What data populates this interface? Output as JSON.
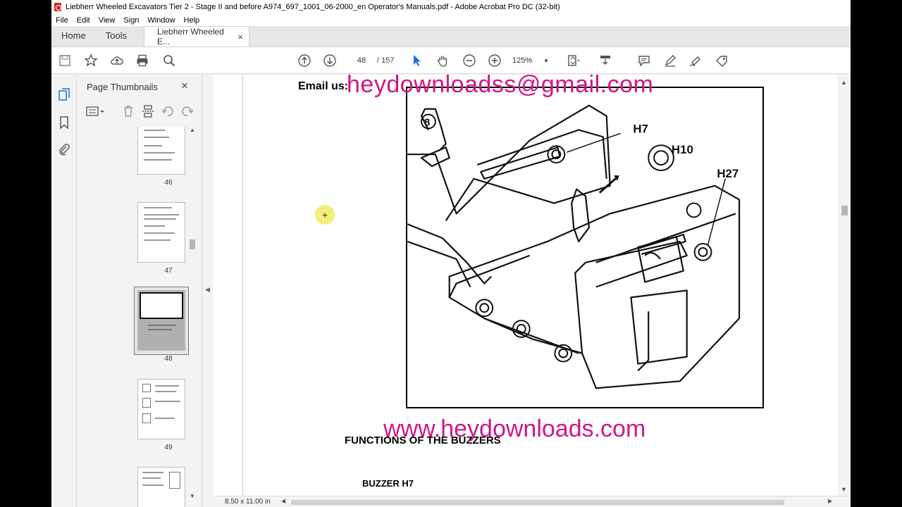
{
  "window": {
    "title": "Liebherr Wheeled Excavators Tier 2 - Stage II and before A974_697_1001_06-2000_en Operator's Manuals.pdf - Adobe Acrobat Pro DC (32-bit)"
  },
  "menu": [
    "File",
    "Edit",
    "View",
    "Sign",
    "Window",
    "Help"
  ],
  "tabs": {
    "home": "Home",
    "tools": "Tools",
    "document": "Liebherr Wheeled E...",
    "close": "×"
  },
  "toolbar": {
    "page_current": "48",
    "page_total": "/ 157",
    "zoom": "125%"
  },
  "thumbnails_panel": {
    "title": "Page Thumbnails",
    "close": "×",
    "pages": [
      {
        "label": "46"
      },
      {
        "label": "47"
      },
      {
        "label": "48",
        "selected": true
      },
      {
        "label": "49"
      }
    ]
  },
  "document": {
    "email_label": "Email us:",
    "email": "heydownloadss@gmail.com",
    "website": "www.heydownloads.com",
    "heading": "FUNCTIONS OF THE BUZZERS",
    "subheading": "BUZZER H7",
    "figure_labels": [
      "H7",
      "H10",
      "H27"
    ],
    "figure_callout": "8"
  },
  "status": {
    "page_size": "8.50 x 11.00 in"
  },
  "colors": {
    "watermark": "#d0168a",
    "cursor_highlight": "#f1ef7a",
    "pdf_icon": "#d9251d"
  }
}
